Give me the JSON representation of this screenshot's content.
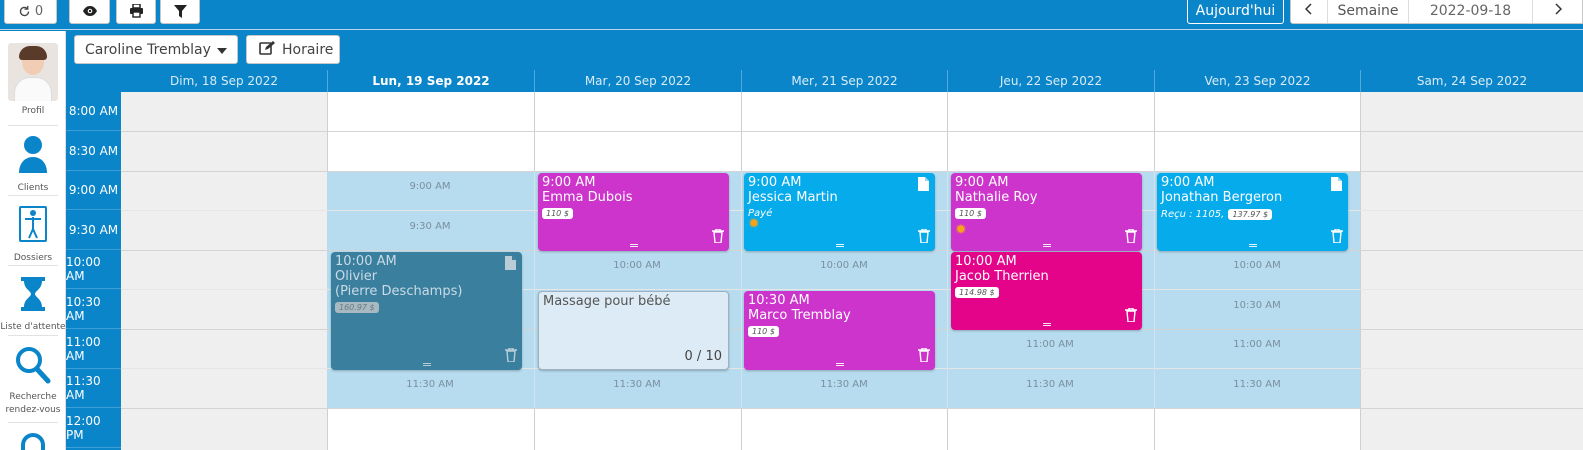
{
  "topbar": {
    "refresh_count": "0",
    "today_label": "Aujourd'hui",
    "view_label": "Semaine",
    "date_value": "2022-09-18"
  },
  "sidebar": {
    "items": [
      {
        "label": "Profil",
        "icon": "profile-photo"
      },
      {
        "label": "Clients",
        "icon": "person-icon"
      },
      {
        "label": "Dossiers",
        "icon": "body-icon"
      },
      {
        "label": "Liste d'attente",
        "icon": "hourglass-icon"
      },
      {
        "label": "Recherche rendez-vous",
        "icon": "magnifier-icon"
      }
    ]
  },
  "toolbar2": {
    "practitioner": "Caroline Tremblay",
    "horaire_label": "Horaire"
  },
  "days": [
    {
      "label": "Dim, 18 Sep 2022"
    },
    {
      "label": "Lun, 19 Sep 2022"
    },
    {
      "label": "Mar, 20 Sep 2022"
    },
    {
      "label": "Mer, 21 Sep 2022"
    },
    {
      "label": "Jeu, 22 Sep 2022"
    },
    {
      "label": "Ven, 23 Sep 2022"
    },
    {
      "label": "Sam, 24 Sep 2022"
    }
  ],
  "times": [
    "8:00 AM",
    "8:30 AM",
    "9:00 AM",
    "9:30 AM",
    "10:00 AM",
    "10:30 AM",
    "11:00 AM",
    "11:30 AM",
    "12:00 PM"
  ],
  "slot_labels": {
    "s900": "9:00 AM",
    "s930": "9:30 AM",
    "s1000": "10:00 AM",
    "s1030": "10:30 AM",
    "s1100": "11:00 AM",
    "s1130": "11:30 AM"
  },
  "events": {
    "olivier": {
      "time": "10:00 AM",
      "name": "Olivier",
      "sub": "(Pierre Deschamps)",
      "price": "160.97 $"
    },
    "emma": {
      "time": "9:00 AM",
      "name": "Emma Dubois",
      "price": "110 $"
    },
    "massage": {
      "title": "Massage pour bébé",
      "count": "0 / 10"
    },
    "jessica": {
      "time": "9:00 AM",
      "name": "Jessica Martin",
      "status": "Payé"
    },
    "marco": {
      "time": "10:30 AM",
      "name": "Marco Tremblay",
      "price": "110 $"
    },
    "nathalie": {
      "time": "9:00 AM",
      "name": "Nathalie Roy",
      "price": "110 $"
    },
    "jacob": {
      "time": "10:00 AM",
      "name": "Jacob Therrien",
      "price": "114.98 $"
    },
    "jonathan": {
      "time": "9:00 AM",
      "name": "Jonathan Bergeron",
      "received": "Reçu : 1105,",
      "price": "137.97 $"
    }
  },
  "colors": {
    "primary": "#0a85c9",
    "available": "#b7dcef",
    "purple": "#cd34cc",
    "blue": "#06abec",
    "pink": "#e4048a",
    "slate": "#3b7f9f"
  }
}
